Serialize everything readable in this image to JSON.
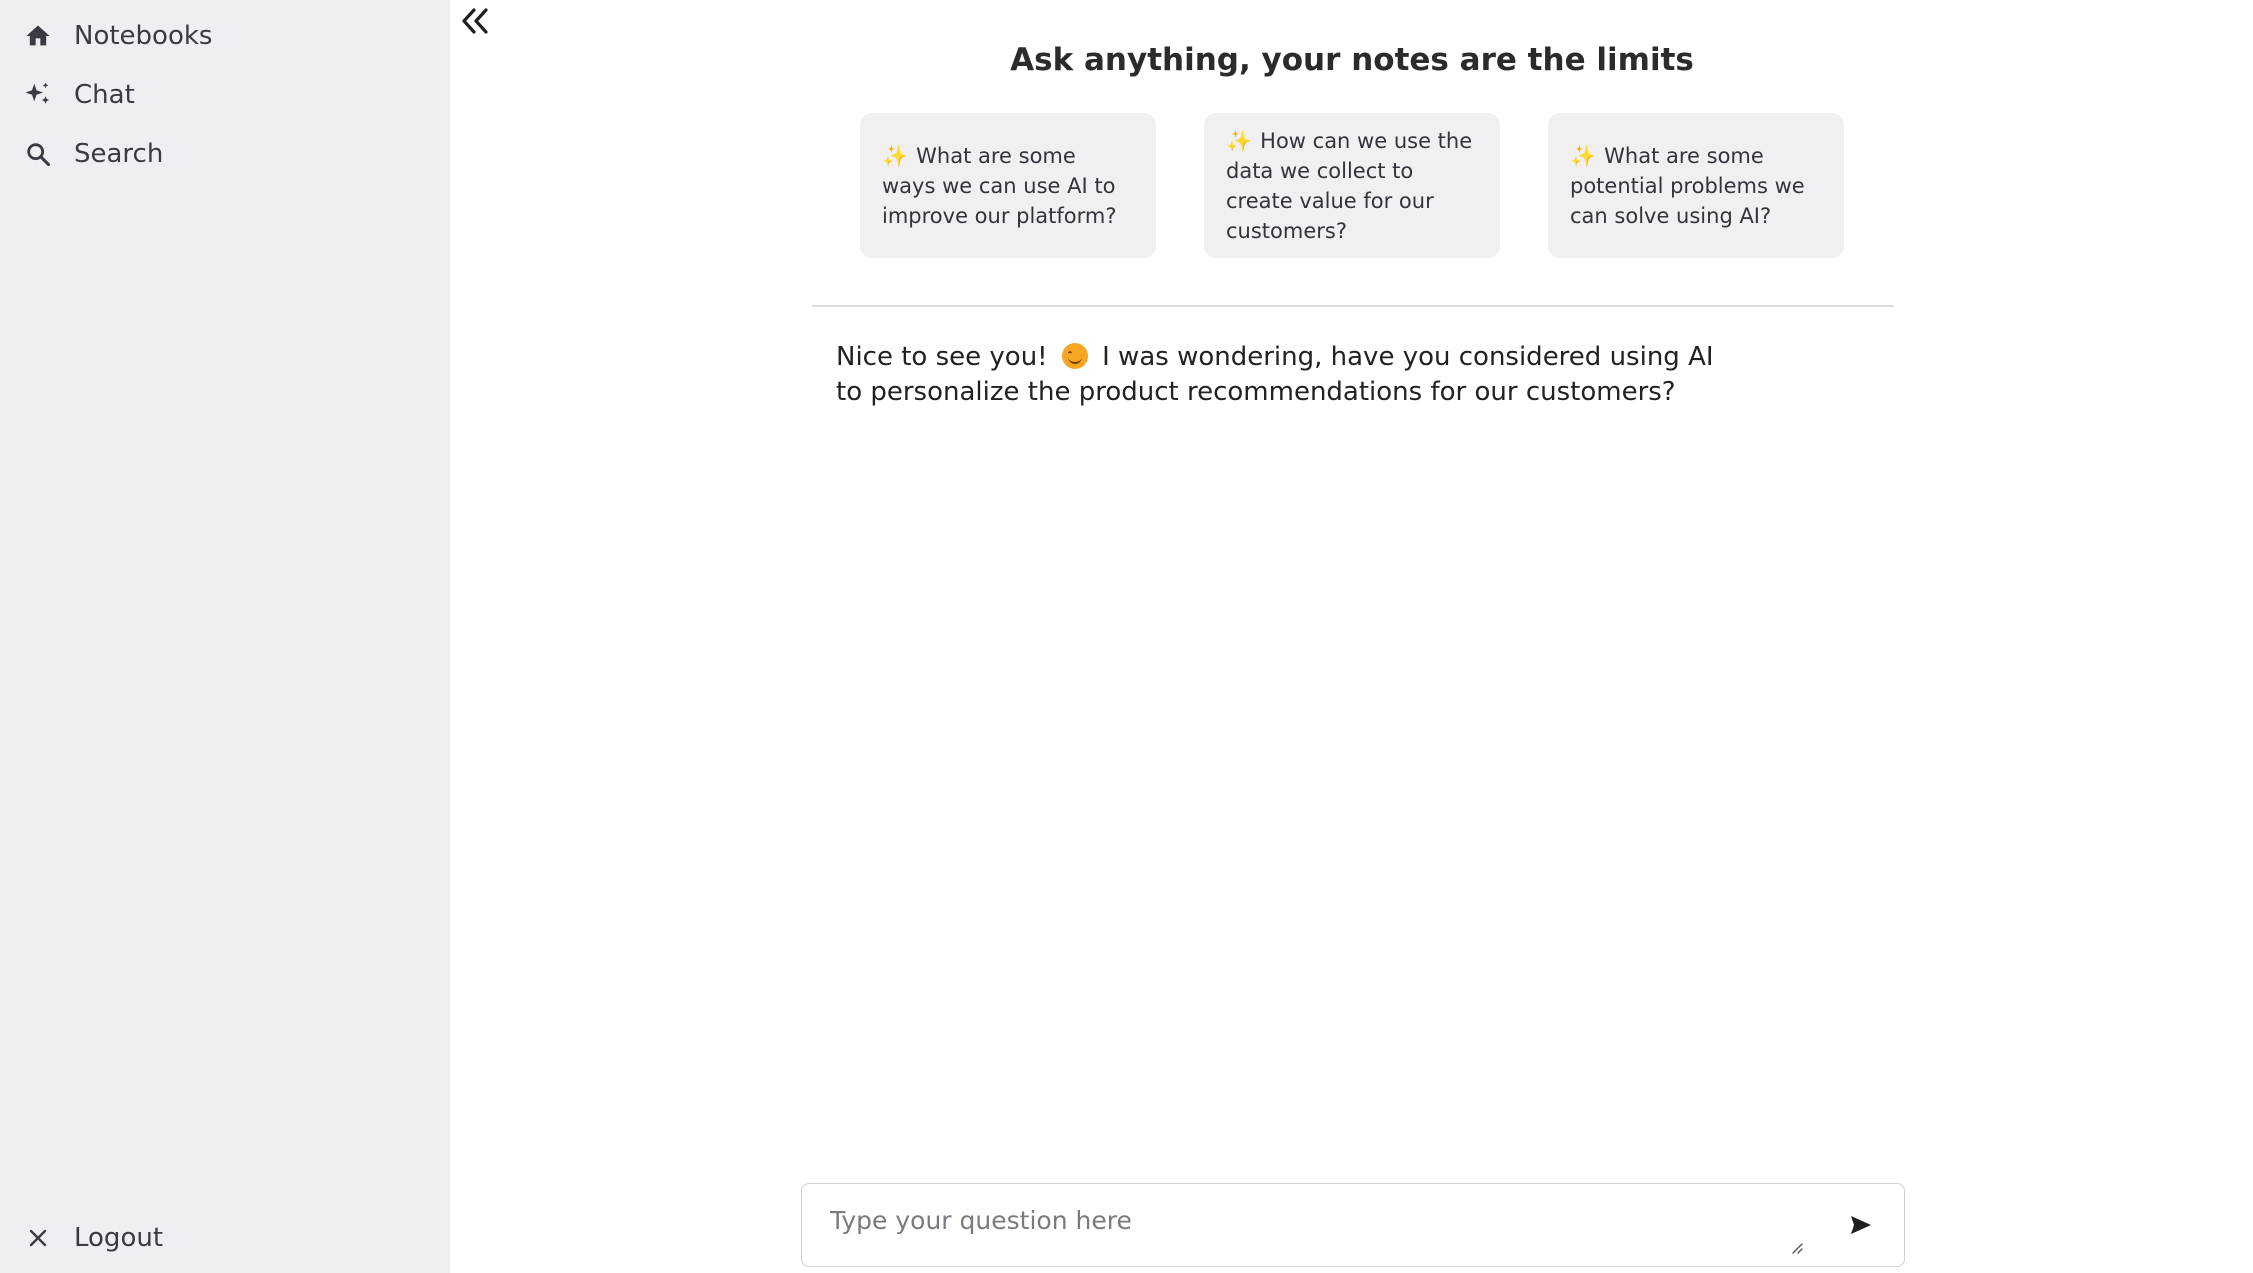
{
  "sidebar": {
    "items": [
      {
        "label": "Notebooks",
        "icon": "home-icon"
      },
      {
        "label": "Chat",
        "icon": "sparkles-icon"
      },
      {
        "label": "Search",
        "icon": "search-icon"
      }
    ],
    "logout": {
      "label": "Logout",
      "icon": "close-icon"
    }
  },
  "main": {
    "heading": "Ask anything, your notes are the limits",
    "suggestions": [
      {
        "icon": "✨",
        "text": "What are some ways we can use AI to improve our platform?"
      },
      {
        "icon": "✨",
        "text": "How can we use the data we collect to create value for our customers?"
      },
      {
        "icon": "✨",
        "text": "What are some potential problems we can solve using AI?"
      }
    ],
    "message": {
      "before_emoji": "Nice to see you!",
      "after_emoji": "I was wondering, have you considered using AI to personalize the product recommendations for our customers?"
    }
  },
  "input": {
    "placeholder": "Type your question here",
    "value": ""
  },
  "colors": {
    "sidebar_bg": "#efeff3",
    "card_bg": "#f0f0f2",
    "sparkle": "#f2b01e"
  }
}
